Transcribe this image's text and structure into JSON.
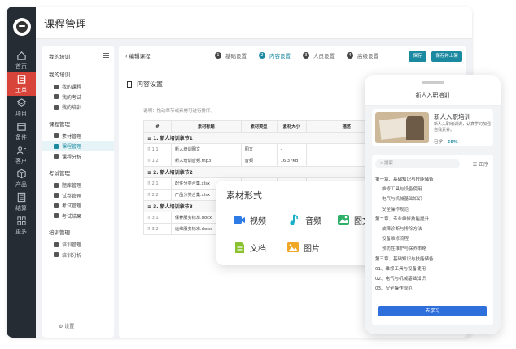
{
  "app": {
    "title": "课程管理"
  },
  "rail": [
    {
      "label": "首页",
      "icon": "home-icon"
    },
    {
      "label": "工单",
      "icon": "clipboard-icon",
      "active": true
    },
    {
      "label": "项目",
      "icon": "layers-icon"
    },
    {
      "label": "备件",
      "icon": "box-icon"
    },
    {
      "label": "客户",
      "icon": "users-icon"
    },
    {
      "label": "产品",
      "icon": "cube-icon"
    },
    {
      "label": "结算",
      "icon": "calculator-icon"
    },
    {
      "label": "更多",
      "icon": "grid-icon"
    }
  ],
  "sidenav": {
    "head": "我的培训",
    "groups": [
      {
        "label": "我的培训",
        "items": [
          "我的课程",
          "我的考试",
          "我的培训"
        ]
      },
      {
        "label": "课程管理",
        "items": [
          "素材管理",
          "课程管理",
          "课程分析"
        ]
      },
      {
        "label": "考试管理",
        "items": [
          "题库管理",
          "试卷管理",
          "考试管理",
          "考试结果"
        ]
      },
      {
        "label": "培训管理",
        "items": [
          "培训管理",
          "培训分析"
        ]
      }
    ],
    "active": "课程管理",
    "settings": "设置"
  },
  "steps": {
    "back": "编辑课程",
    "items": [
      {
        "num": "1",
        "label": "基础设置"
      },
      {
        "num": "2",
        "label": "内容设置",
        "active": true
      },
      {
        "num": "3",
        "label": "人员设置"
      },
      {
        "num": "4",
        "label": "高级设置"
      }
    ],
    "save": "保存",
    "save_publish": "保存并上架"
  },
  "content": {
    "section_title": "内容设置",
    "tip": "说明：拖动章节或素材可进行排序。",
    "columns": [
      "#",
      "素材标题",
      "素材类型",
      "素材大小",
      "描述"
    ],
    "rows": [
      {
        "group": true,
        "title": "1. 新人培训章节1"
      },
      {
        "num": "1.1",
        "title": "新人培训图文",
        "type": "图文",
        "size": "-",
        "desc": ""
      },
      {
        "num": "1.2",
        "title": "新人培训音频.mp3",
        "type": "音频",
        "size": "16.37KB",
        "desc": ""
      },
      {
        "group": true,
        "title": "2. 新人培训章节2"
      },
      {
        "num": "2.1",
        "title": "配件分类合集.xlsx",
        "type": "",
        "size": "",
        "desc": ""
      },
      {
        "num": "2.2",
        "title": "产品分类合集.xlsx",
        "type": "",
        "size": "",
        "desc": ""
      },
      {
        "group": true,
        "title": "3. 新人培训章节3"
      },
      {
        "num": "3.1",
        "title": "保养服务标准.docx",
        "type": "",
        "size": "",
        "desc": ""
      },
      {
        "num": "3.2",
        "title": "运维服务标准.docx",
        "type": "",
        "size": "",
        "desc": ""
      }
    ]
  },
  "material": {
    "title": "素材形式",
    "items": [
      {
        "label": "视频",
        "icon": "video-icon",
        "color": "#2f7be5"
      },
      {
        "label": "音频",
        "icon": "music-icon",
        "color": "#1ab0c9"
      },
      {
        "label": "图文",
        "icon": "image-icon",
        "color": "#2fb06a"
      },
      {
        "label": "文档",
        "icon": "document-icon",
        "color": "#8ac12f"
      },
      {
        "label": "图片",
        "icon": "picture-icon",
        "color": "#f0a726"
      }
    ]
  },
  "phone": {
    "title": "新人入职培训",
    "card": {
      "title": "新人入职培训",
      "desc": "新人入职培训课，认真学习加强自我素养。",
      "progress_label": "已学：",
      "progress": "56%"
    },
    "search_placeholder": "搜索",
    "list_toggle": "正序",
    "lines": [
      {
        "text": "第一章、基础知识与技能储备",
        "sub": false
      },
      {
        "text": "维修工具与设备使用",
        "sub": true
      },
      {
        "text": "电气与机械基础知识",
        "sub": true
      },
      {
        "text": "安全操作规范",
        "sub": true
      },
      {
        "text": "第二章、专业维修技能提升",
        "sub": false
      },
      {
        "text": "故障诊断与排除方法",
        "sub": true
      },
      {
        "text": "设备维修流程",
        "sub": true
      },
      {
        "text": "预防性维护与保养策略",
        "sub": true
      },
      {
        "text": "第三章、基础知识与技能储备",
        "sub": false
      },
      {
        "text": "01、维修工具与设备使用",
        "sub": false
      },
      {
        "text": "02、电气与机械基础知识",
        "sub": false
      },
      {
        "text": "03、安全操作规范",
        "sub": false
      }
    ],
    "learn_button": "去学习"
  }
}
